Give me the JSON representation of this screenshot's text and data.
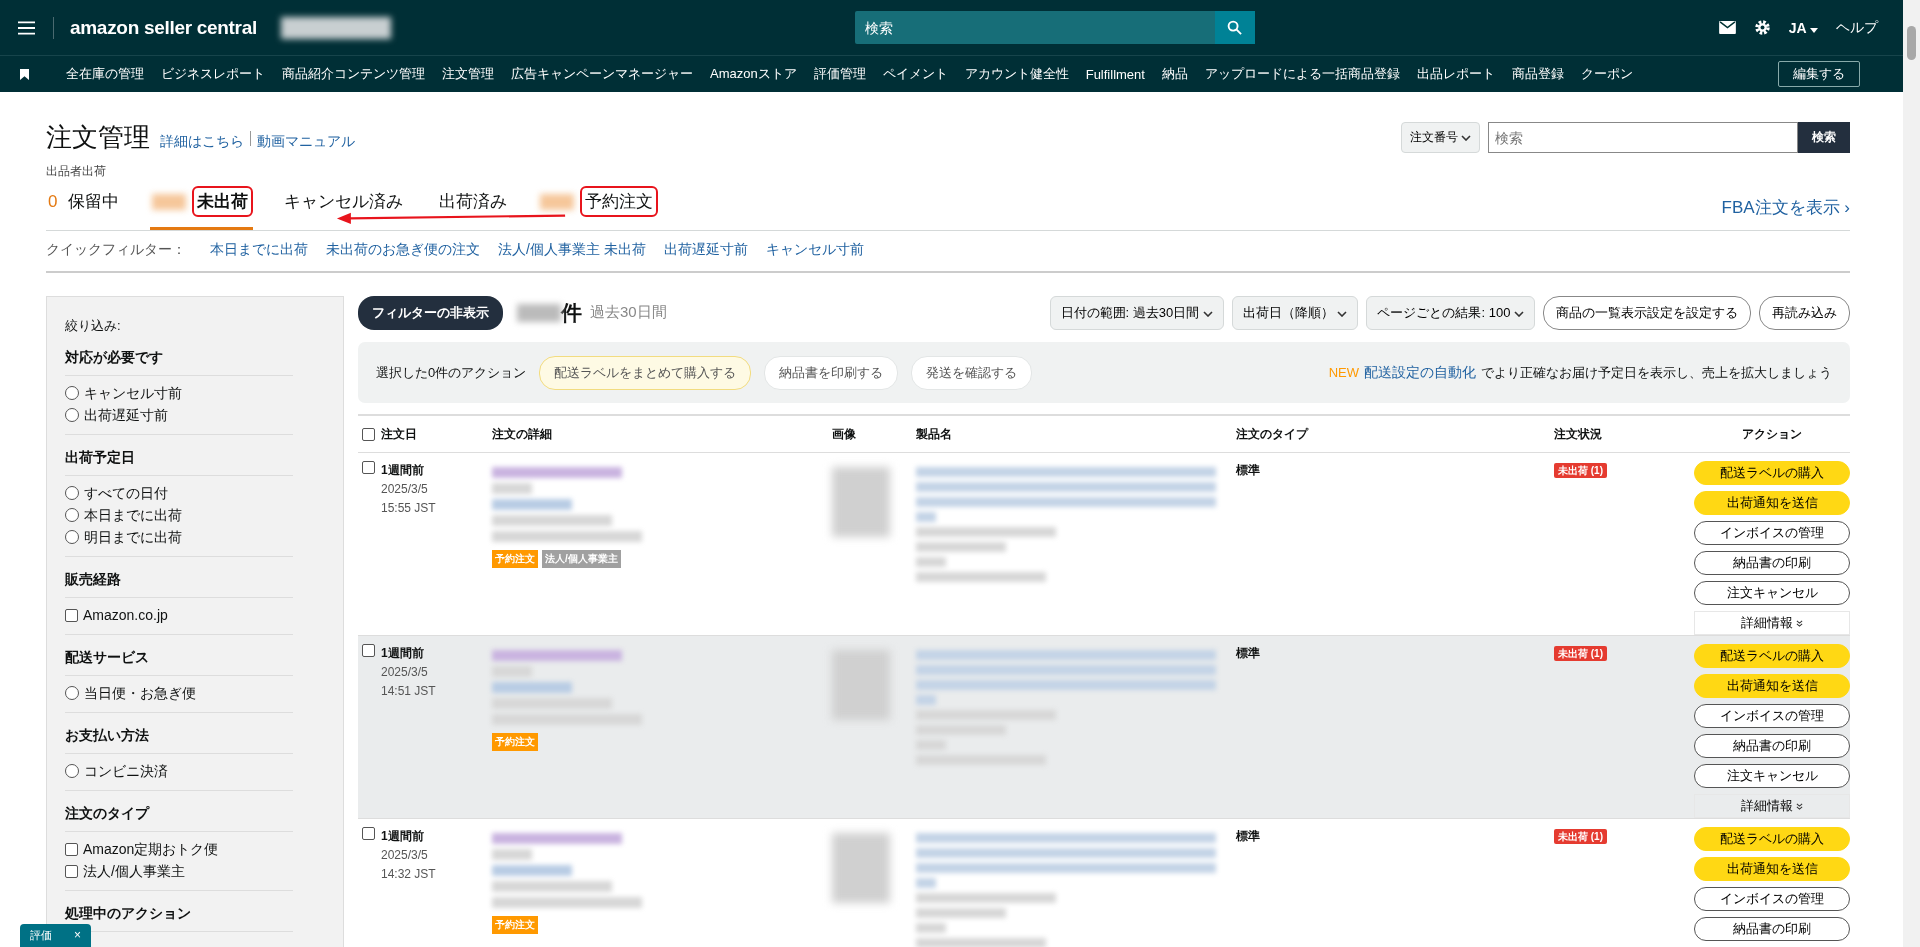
{
  "topbar": {
    "logo": "amazon seller central",
    "search_placeholder": "検索",
    "language": "JA",
    "help": "ヘルプ"
  },
  "nav": {
    "items": [
      "全在庫の管理",
      "ビジネスレポート",
      "商品紹介コンテンツ管理",
      "注文管理",
      "広告キャンペーンマネージャー",
      "Amazonストア",
      "評価管理",
      "ペイメント",
      "アカウント健全性",
      "Fulfillment",
      "納品",
      "アップロードによる一括商品登録",
      "出品レポート",
      "商品登録",
      "クーポン"
    ],
    "edit_button": "編集する"
  },
  "header": {
    "title": "注文管理",
    "links": [
      "詳細はこちら",
      "動画マニュアル"
    ],
    "search_type": "注文番号",
    "search_placeholder": "検索",
    "search_button": "検索"
  },
  "subtitle": "出品者出荷",
  "tabs": [
    {
      "count": "0",
      "count_hidden": false,
      "label": "保留中",
      "selected": false,
      "highlighted": false
    },
    {
      "count_hidden": true,
      "label": "未出荷",
      "selected": true,
      "highlighted": true
    },
    {
      "count_hidden": false,
      "label": "キャンセル済み",
      "selected": false,
      "highlighted": false
    },
    {
      "count_hidden": false,
      "label": "出荷済み",
      "selected": false,
      "highlighted": false
    },
    {
      "count_hidden": true,
      "label": "予約注文",
      "selected": false,
      "highlighted": true
    }
  ],
  "fba_link": "FBA注文を表示 ›",
  "quick_filters": {
    "label": "クイックフィルター：",
    "items": [
      "本日までに出荷",
      "未出荷のお急ぎ便の注文",
      "法人/個人事業主 未出荷",
      "出荷遅延寸前",
      "キャンセル寸前"
    ]
  },
  "sidebar": {
    "title": "絞り込み:",
    "groups": [
      {
        "heading": "対応が必要です",
        "options": [
          {
            "kind": "radio",
            "label": "キャンセル寸前",
            "checked": false
          },
          {
            "kind": "radio",
            "label": "出荷遅延寸前",
            "checked": false
          }
        ]
      },
      {
        "heading": "出荷予定日",
        "options": [
          {
            "kind": "radio",
            "label": "すべての日付",
            "checked": false
          },
          {
            "kind": "radio",
            "label": "本日までに出荷",
            "checked": false
          },
          {
            "kind": "radio",
            "label": "明日までに出荷",
            "checked": false
          }
        ]
      },
      {
        "heading": "販売経路",
        "options": [
          {
            "kind": "checkbox",
            "label": "Amazon.co.jp",
            "checked": false
          }
        ]
      },
      {
        "heading": "配送サービス",
        "options": [
          {
            "kind": "radio",
            "label": "当日便・お急ぎ便",
            "checked": false
          }
        ]
      },
      {
        "heading": "お支払い方法",
        "options": [
          {
            "kind": "radio",
            "label": "コンビニ決済",
            "checked": false
          }
        ]
      },
      {
        "heading": "注文のタイプ",
        "options": [
          {
            "kind": "checkbox",
            "label": "Amazon定期おトク便",
            "checked": false
          },
          {
            "kind": "checkbox",
            "label": "法人/個人事業主",
            "checked": false
          }
        ]
      },
      {
        "heading": "処理中のアクション"
      }
    ]
  },
  "toolbar": {
    "filter_toggle": "フィルターの非表示",
    "count_unit": "件",
    "period": "過去30日間",
    "dropdowns": [
      "日付の範囲: 過去30日間",
      "出荷日（降順）",
      "ページごとの結果: 100"
    ],
    "buttons": [
      "商品の一覧表示設定を設定する",
      "再読み込み"
    ]
  },
  "bulk": {
    "label": "選択した0件のアクション",
    "buttons": [
      {
        "label": "配送ラベルをまとめて購入する",
        "kind": "primary"
      },
      {
        "label": "納品書を印刷する",
        "kind": "plain"
      },
      {
        "label": "発送を確認する",
        "kind": "plain"
      }
    ],
    "new_tag": "NEW",
    "promo_link": "配送設定の自動化",
    "promo_text": "でより正確なお届け予定日を表示し、売上を拡大しましょう"
  },
  "table": {
    "select_all_checked": false,
    "columns": [
      "注文日",
      "注文の詳細",
      "画像",
      "製品名",
      "注文のタイプ",
      "注文状況",
      "アクション"
    ],
    "rows": [
      {
        "checked": false,
        "hovered": false,
        "relative": "1週間前",
        "date": "2025/3/5",
        "time": "15:55 JST",
        "tags": [
          {
            "label": "予約注文",
            "color": "#ff9900"
          },
          {
            "label": "法人/個人事業主",
            "color": "#a0a0a0"
          }
        ],
        "type": "標準",
        "status": "未出荷 (1)",
        "actions": [
          {
            "label": "配送ラベルの購入",
            "kind": "primary"
          },
          {
            "label": "出荷通知を送信",
            "kind": "primary"
          },
          {
            "label": "インボイスの管理",
            "kind": "plain"
          },
          {
            "label": "納品書の印刷",
            "kind": "plain"
          },
          {
            "label": "注文キャンセル",
            "kind": "plain"
          }
        ],
        "more": "詳細情報"
      },
      {
        "checked": false,
        "hovered": true,
        "relative": "1週間前",
        "date": "2025/3/5",
        "time": "14:51 JST",
        "tags": [
          {
            "label": "予約注文",
            "color": "#ff9900"
          }
        ],
        "type": "標準",
        "status": "未出荷 (1)",
        "actions": [
          {
            "label": "配送ラベルの購入",
            "kind": "primary"
          },
          {
            "label": "出荷通知を送信",
            "kind": "primary"
          },
          {
            "label": "インボイスの管理",
            "kind": "plain"
          },
          {
            "label": "納品書の印刷",
            "kind": "plain"
          },
          {
            "label": "注文キャンセル",
            "kind": "plain"
          }
        ],
        "more": "詳細情報"
      },
      {
        "checked": false,
        "hovered": false,
        "relative": "1週間前",
        "date": "2025/3/5",
        "time": "14:32 JST",
        "tags": [
          {
            "label": "予約注文",
            "color": "#ff9900"
          }
        ],
        "type": "標準",
        "status": "未出荷 (1)",
        "actions": [
          {
            "label": "配送ラベルの購入",
            "kind": "primary"
          },
          {
            "label": "出荷通知を送信",
            "kind": "primary"
          },
          {
            "label": "インボイスの管理",
            "kind": "plain"
          },
          {
            "label": "納品書の印刷",
            "kind": "plain"
          }
        ]
      }
    ]
  },
  "feedback_tab": {
    "label": "評価",
    "close": "×"
  }
}
